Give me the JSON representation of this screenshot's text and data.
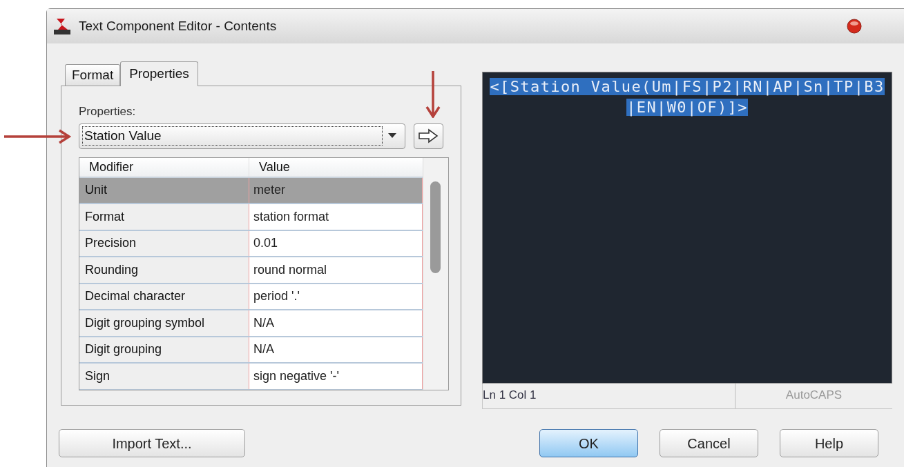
{
  "window": {
    "title": "Text Component Editor - Contents"
  },
  "tabs": [
    {
      "label": "Format",
      "selected": false
    },
    {
      "label": "Properties",
      "selected": true
    }
  ],
  "properties": {
    "label": "Properties:",
    "value": "Station Value"
  },
  "table": {
    "columns": [
      "Modifier",
      "Value"
    ],
    "rows": [
      {
        "modifier": "Unit",
        "value": "meter",
        "selected": true
      },
      {
        "modifier": "Format",
        "value": "station format",
        "selected": false
      },
      {
        "modifier": "Precision",
        "value": "0.01",
        "selected": false
      },
      {
        "modifier": "Rounding",
        "value": "round normal",
        "selected": false
      },
      {
        "modifier": "Decimal character",
        "value": "period '.'",
        "selected": false
      },
      {
        "modifier": "Digit grouping symbol",
        "value": "N/A",
        "selected": false
      },
      {
        "modifier": "Digit grouping",
        "value": "N/A",
        "selected": false
      },
      {
        "modifier": "Sign",
        "value": "sign negative '-'",
        "selected": false
      }
    ]
  },
  "editor": {
    "text": "<[Station Value(Um|FS|P2|RN|AP|Sn|TP|B3|EN|W0|OF)]>",
    "selected": true
  },
  "status_bar": {
    "position": "Ln 1 Col 1",
    "autocaps": "AutoCAPS"
  },
  "buttons": [
    {
      "label": "Import Text...",
      "default": false
    },
    {
      "label": "OK",
      "default": true
    },
    {
      "label": "Cancel",
      "default": false
    },
    {
      "label": "Help",
      "default": false
    }
  ]
}
